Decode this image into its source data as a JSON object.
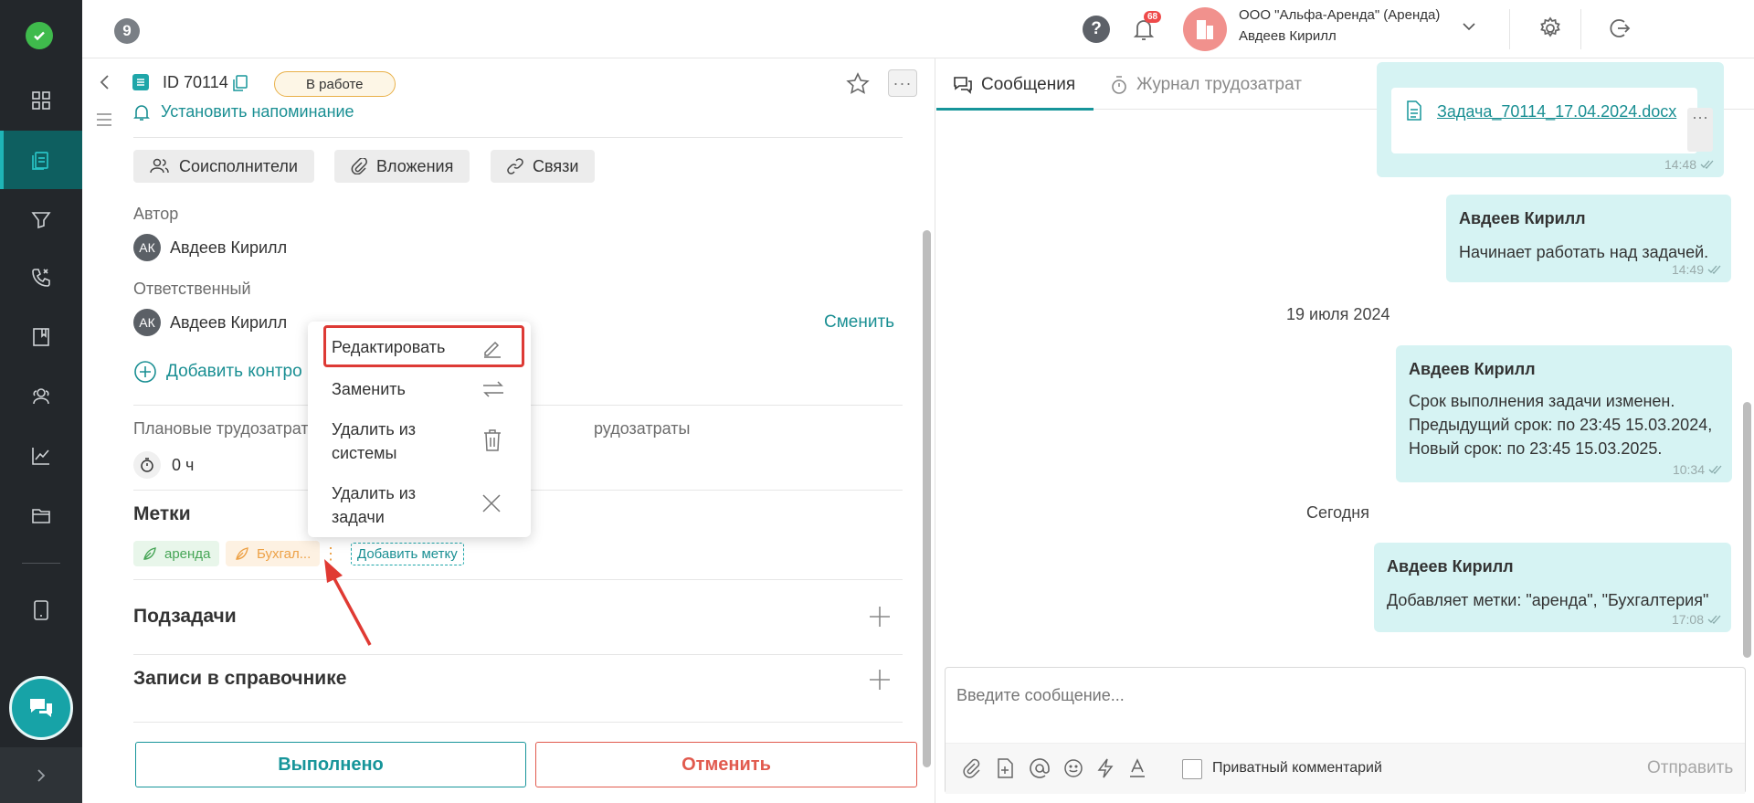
{
  "topbar": {
    "counter": "9",
    "help": "?",
    "notifications": "68",
    "org_name": "ООО \"Альфа-Аренда\" (Аренда)",
    "user_name": "Авдеев Кирилл"
  },
  "task": {
    "id": "ID 70114",
    "status": "В работе",
    "reminder": "Установить напоминание",
    "pills": {
      "coexec": "Соисполнители",
      "attach": "Вложения",
      "links": "Связи"
    },
    "author_label": "Автор",
    "author_initials": "АК",
    "author": "Авдеев Кирилл",
    "resp_label": "Ответственный",
    "resp_initials": "АК",
    "resp": "Авдеев Кирилл",
    "change": "Сменить",
    "add_control": "Добавить контро",
    "plan_label": "Плановые трудозатрат",
    "fact_label": "рудозатраты",
    "plan_value": "0 ч",
    "tags_title": "Метки",
    "tags": [
      "аренда",
      "Бухгал..."
    ],
    "add_tag": "Добавить метку",
    "subtasks": "Подзадачи",
    "records": "Записи в справочнике",
    "done": "Выполнено",
    "cancel": "Отменить"
  },
  "context_menu": {
    "edit": "Редактировать",
    "replace": "Заменить",
    "delete_sys_1": "Удалить из",
    "delete_sys_2": "системы",
    "delete_task_1": "Удалить из",
    "delete_task_2": "задачи"
  },
  "messages": {
    "tab_messages": "Сообщения",
    "tab_log": "Журнал трудозатрат",
    "file_name": "Задача_70114_17.04.2024.docx",
    "file_time": "14:48",
    "m1_author": "Авдеев Кирилл",
    "m1_text": "Начинает работать над задачей.",
    "m1_time": "14:49",
    "date1": "19 июля 2024",
    "m2_author": "Авдеев Кирилл",
    "m2_line1": "Срок выполнения задачи изменен.",
    "m2_line2": "Предыдущий срок: по 23:45 15.03.2024,",
    "m2_line3": "Новый срок: по 23:45 15.03.2025.",
    "m2_time": "10:34",
    "date2": "Сегодня",
    "m3_author": "Авдеев Кирилл",
    "m3_text": "Добавляет метки: \"аренда\", \"Бухгалтерия\"",
    "m3_time": "17:08",
    "input_placeholder": "Введите сообщение...",
    "private_comment": "Приватный комментарий",
    "send": "Отправить"
  },
  "colors": {
    "accent": "#17959a",
    "rail": "#23272b",
    "rail_active": "#0e5f60",
    "bubble": "#d6f3f3",
    "danger": "#e15a4e",
    "highlight": "#dd3a35",
    "status_border": "#e9b14a"
  }
}
